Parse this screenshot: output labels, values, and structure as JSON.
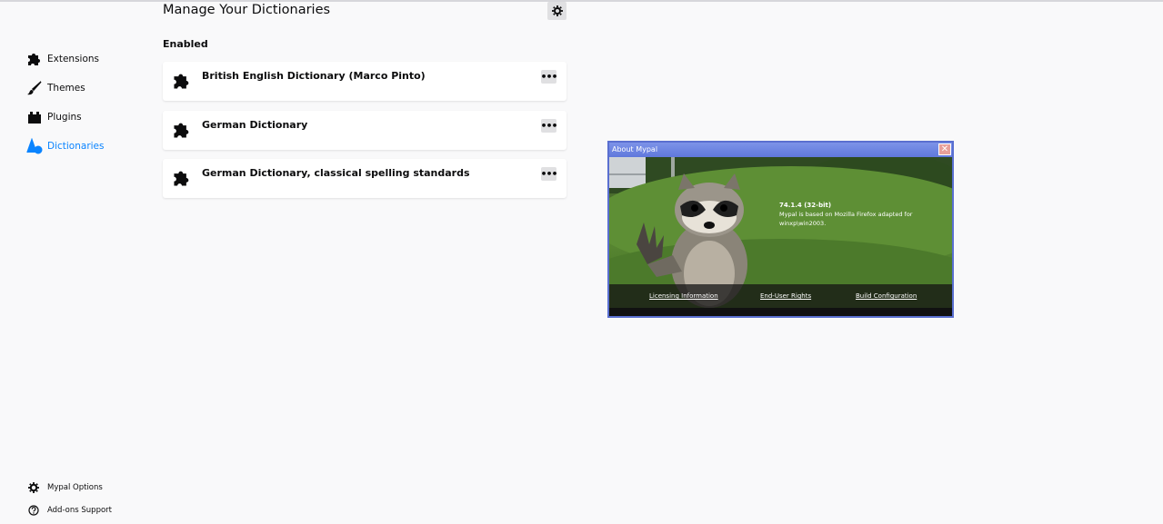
{
  "sidebar": {
    "items": [
      {
        "label": "Extensions",
        "icon": "puzzle-icon"
      },
      {
        "label": "Themes",
        "icon": "brush-icon"
      },
      {
        "label": "Plugins",
        "icon": "plugin-icon"
      },
      {
        "label": "Dictionaries",
        "icon": "dictionary-icon",
        "active": true
      }
    ],
    "footer": [
      {
        "label": "Mypal Options",
        "icon": "gear-icon"
      },
      {
        "label": "Add-ons Support",
        "icon": "help-icon"
      }
    ]
  },
  "main": {
    "title": "Manage Your Dictionaries",
    "section_title": "Enabled",
    "dictionaries": [
      {
        "name": "British English Dictionary (Marco Pinto)"
      },
      {
        "name": "German Dictionary"
      },
      {
        "name": "German Dictionary, classical spelling standards"
      }
    ],
    "more_label": "•••"
  },
  "about_dialog": {
    "title": "About Mypal",
    "close_label": "✕",
    "version": "74.1.4 (32-bit)",
    "description_line1": "Mypal is based on Mozilla Firefox adapted for",
    "description_line2": "winxp\\win2003.",
    "links": {
      "licensing": "Licensing Information",
      "rights": "End-User Rights",
      "build": "Build Configuration"
    }
  },
  "colors": {
    "accent": "#0a84ff",
    "background": "#f9f9fa",
    "dialog_border": "#5a6fd0"
  }
}
